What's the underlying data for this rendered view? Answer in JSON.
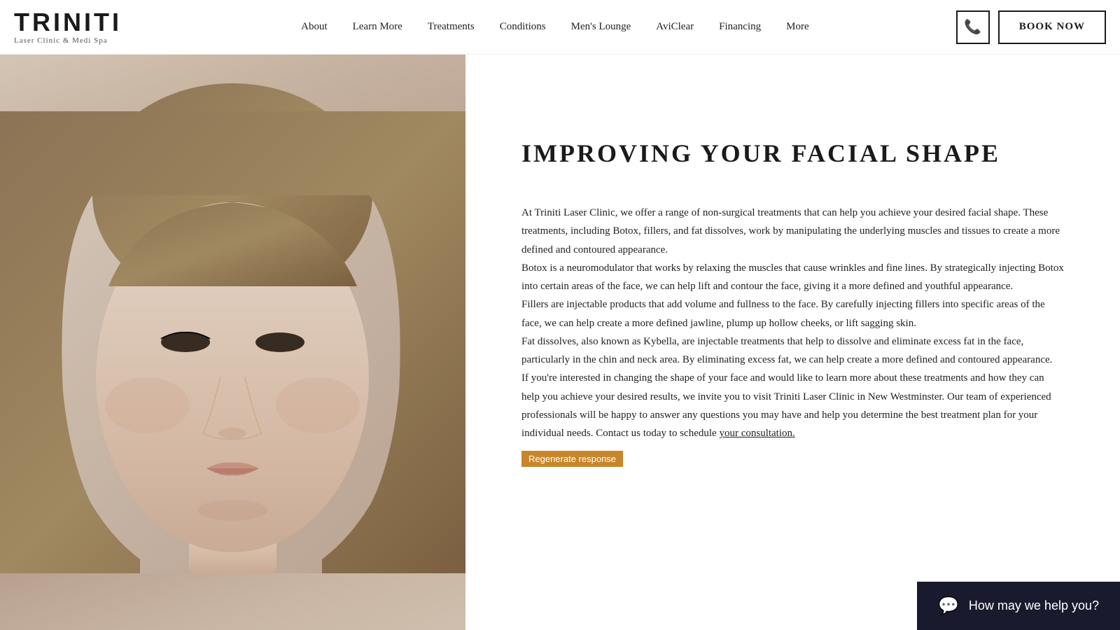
{
  "logo": {
    "text": "TRINITI",
    "subtitle": "Laser Clinic & Medi Spa"
  },
  "nav": {
    "items": [
      {
        "label": "About",
        "href": "#"
      },
      {
        "label": "Learn More",
        "href": "#"
      },
      {
        "label": "Treatments",
        "href": "#"
      },
      {
        "label": "Conditions",
        "href": "#"
      },
      {
        "label": "Men's Lounge",
        "href": "#"
      },
      {
        "label": "AviClear",
        "href": "#"
      },
      {
        "label": "Financing",
        "href": "#"
      },
      {
        "label": "More",
        "href": "#"
      }
    ]
  },
  "header": {
    "book_now": "BOOK NOW"
  },
  "main": {
    "title": "IMPROVING YOUR FACIAL SHAPE",
    "body": "At Triniti Laser Clinic, we offer a range of non-surgical treatments that can help you achieve your desired facial shape. These treatments, including Botox, fillers, and fat dissolves, work by manipulating the underlying muscles and tissues to create a more defined and contoured appearance.\nBotox is a neuromodulator that works by relaxing the muscles that cause wrinkles and fine lines. By strategically injecting Botox into certain areas of the face, we can help lift and contour the face, giving it a more defined and youthful appearance.\nFillers are injectable products that add volume and fullness to the face. By carefully injecting fillers into specific areas of the face, we can help create a more defined jawline, plump up hollow cheeks, or lift sagging skin.\nFat dissolves, also known as Kybella, are injectable treatments that help to dissolve and eliminate excess fat in the face, particularly in the chin and neck area. By eliminating excess fat, we can help create a more defined and contoured appearance.\nIf you're interested in changing the shape of your face and would like to learn more about these treatments and how they can help you achieve your desired results, we invite you to visit Triniti Laser Clinic in New Westminster. Our team of experienced professionals will be happy to answer any questions you may have and help you determine the best treatment plan for your individual needs. Contact us today to schedule your consultation.",
    "consultation_link": "your consultation.",
    "regenerate_label": "Regenerate response"
  },
  "chat": {
    "label": "How may we help you?"
  },
  "colors": {
    "accent": "#c8862a",
    "dark": "#1a1a1a",
    "chat_bg": "#1a1a2e"
  }
}
